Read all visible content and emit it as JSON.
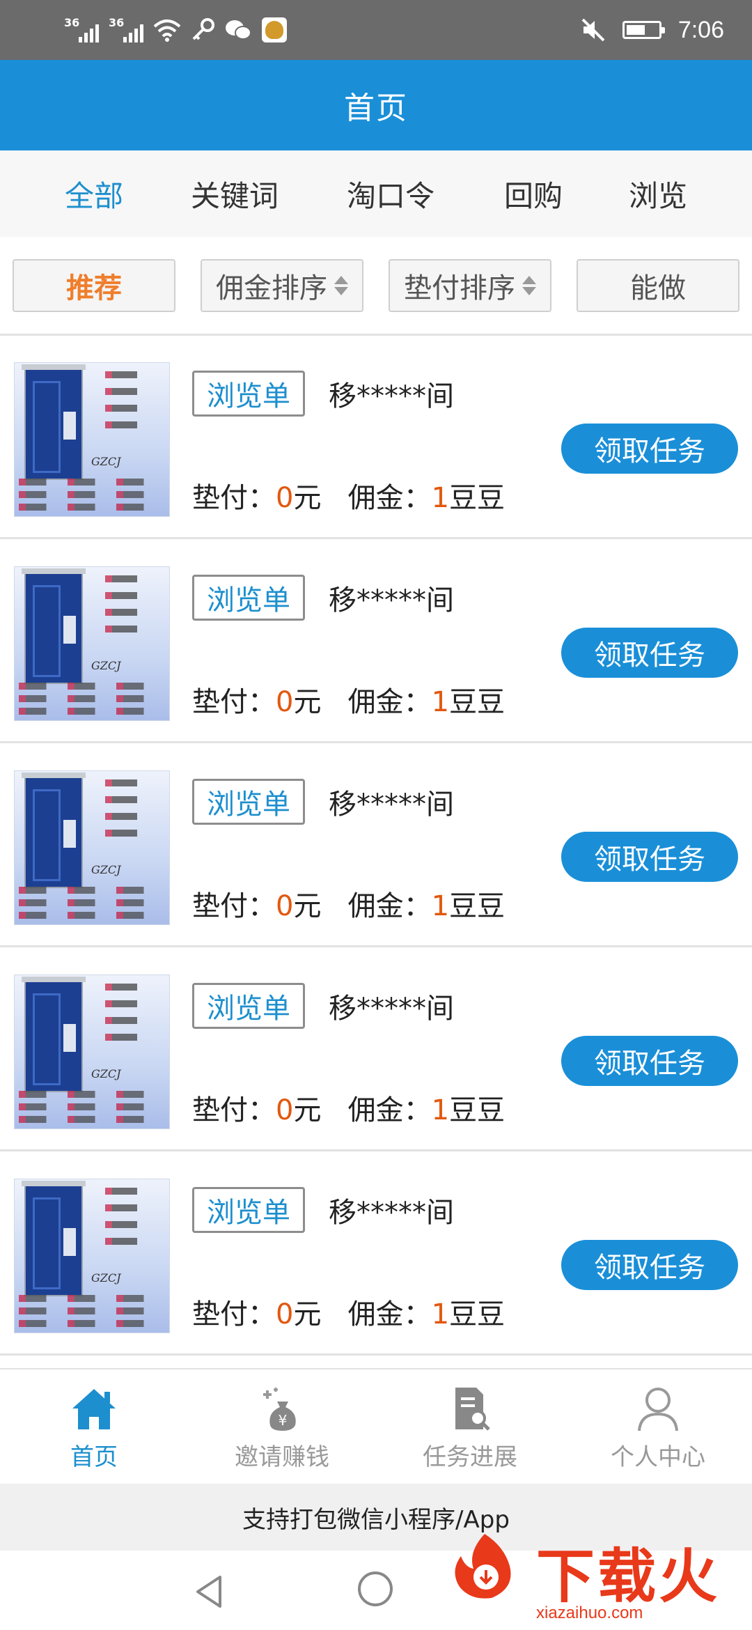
{
  "status_bar": {
    "signal1_label": "36",
    "signal2_label": "36",
    "time": "7:06",
    "battery_level": 0.6,
    "icons": [
      "signal-icon",
      "signal-icon",
      "wifi-icon",
      "key-icon",
      "wechat-icon",
      "money-bag-icon",
      "mute-icon",
      "battery-icon"
    ]
  },
  "header": {
    "title": "首页"
  },
  "category_tabs": [
    {
      "label": "全部",
      "active": true
    },
    {
      "label": "关键词",
      "active": false
    },
    {
      "label": "淘口令",
      "active": false
    },
    {
      "label": "回购",
      "active": false
    },
    {
      "label": "浏览",
      "active": false
    }
  ],
  "filters": [
    {
      "label": "推荐",
      "active": true,
      "sortable": false
    },
    {
      "label": "佣金排序",
      "active": false,
      "sortable": true
    },
    {
      "label": "垫付排序",
      "active": false,
      "sortable": true
    },
    {
      "label": "能做",
      "active": false,
      "sortable": false
    }
  ],
  "labels": {
    "advance_label": "垫付：",
    "advance_unit": "元",
    "commission_label": "佣金：",
    "commission_unit": "豆豆"
  },
  "tasks": [
    {
      "type": "浏览单",
      "name": "移*****间",
      "advance": "0",
      "commission": "1",
      "button": "领取任务",
      "thumb_brand": "GZCJ"
    },
    {
      "type": "浏览单",
      "name": "移*****间",
      "advance": "0",
      "commission": "1",
      "button": "领取任务",
      "thumb_brand": "GZCJ"
    },
    {
      "type": "浏览单",
      "name": "移*****间",
      "advance": "0",
      "commission": "1",
      "button": "领取任务",
      "thumb_brand": "GZCJ"
    },
    {
      "type": "浏览单",
      "name": "移*****间",
      "advance": "0",
      "commission": "1",
      "button": "领取任务",
      "thumb_brand": "GZCJ"
    },
    {
      "type": "浏览单",
      "name": "移*****间",
      "advance": "0",
      "commission": "1",
      "button": "领取任务",
      "thumb_brand": "GZCJ"
    }
  ],
  "bottom_nav": [
    {
      "label": "首页",
      "icon": "home-icon",
      "active": true
    },
    {
      "label": "邀请赚钱",
      "icon": "money-bag-icon",
      "active": false
    },
    {
      "label": "任务进展",
      "icon": "document-search-icon",
      "active": false
    },
    {
      "label": "个人中心",
      "icon": "user-icon",
      "active": false
    }
  ],
  "footer_note": "支持打包微信小程序/App",
  "watermark": {
    "title": "下载火",
    "url": "xiazaihuo.com"
  },
  "colors": {
    "primary": "#1a8fd8",
    "accent_orange": "#ef7e2c",
    "number_orange": "#e2580f",
    "status_bar": "#6b6b6b",
    "watermark_red": "#e8391a"
  }
}
